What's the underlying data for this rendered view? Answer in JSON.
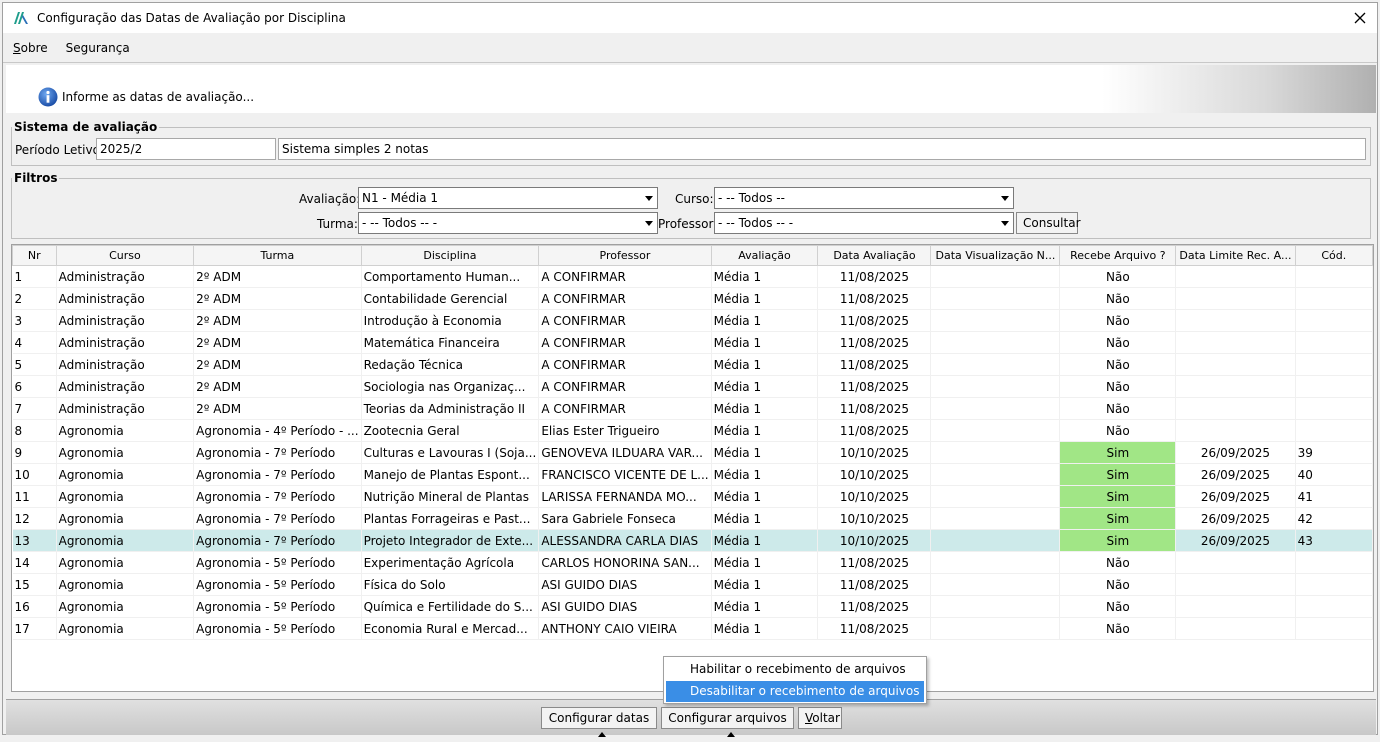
{
  "window": {
    "title": "Configuração das Datas de Avaliação por Disciplina"
  },
  "menu": {
    "sobre_first": "S",
    "sobre_rest": "obre",
    "seguranca": "Segurança"
  },
  "banner": {
    "text": "Informe as datas de avaliação..."
  },
  "sistema": {
    "legend": "Sistema de avaliação",
    "periodo_label": "Período Letivo:",
    "periodo_value": "2025/2",
    "sistema_value": "Sistema simples 2 notas"
  },
  "filtros": {
    "legend": "Filtros",
    "avaliacao_label": "Avaliação:",
    "avaliacao_value": "N1 - Média 1",
    "curso_label": "Curso:",
    "curso_value": "- -- Todos --",
    "turma_label": "Turma:",
    "turma_value": "- -- Todos -- -",
    "professor_label": "Professor:",
    "professor_value": "- -- Todos -- -",
    "consultar": "Consultar"
  },
  "table": {
    "columns": [
      "Nr",
      "Curso",
      "Turma",
      "Disciplina",
      "Professor",
      "Avaliação",
      "Data Avaliação",
      "Data Visualização N...",
      "Recebe Arquivo ?",
      "Data Limite Rec. A...",
      "Cód."
    ],
    "rows": [
      [
        "1",
        "Administração",
        "2º ADM",
        "Comportamento Human...",
        "A CONFIRMAR",
        "Média 1",
        "11/08/2025",
        "",
        "Não",
        "",
        ""
      ],
      [
        "2",
        "Administração",
        "2º ADM",
        "Contabilidade Gerencial",
        "A CONFIRMAR",
        "Média 1",
        "11/08/2025",
        "",
        "Não",
        "",
        ""
      ],
      [
        "3",
        "Administração",
        "2º ADM",
        "Introdução à Economia",
        "A CONFIRMAR",
        "Média 1",
        "11/08/2025",
        "",
        "Não",
        "",
        ""
      ],
      [
        "4",
        "Administração",
        "2º ADM",
        "Matemática Financeira",
        "A CONFIRMAR",
        "Média 1",
        "11/08/2025",
        "",
        "Não",
        "",
        ""
      ],
      [
        "5",
        "Administração",
        "2º ADM",
        "Redação Técnica",
        "A CONFIRMAR",
        "Média 1",
        "11/08/2025",
        "",
        "Não",
        "",
        ""
      ],
      [
        "6",
        "Administração",
        "2º ADM",
        "Sociologia nas Organizaç...",
        "A CONFIRMAR",
        "Média 1",
        "11/08/2025",
        "",
        "Não",
        "",
        ""
      ],
      [
        "7",
        "Administração",
        "2º ADM",
        "Teorias da Administração II",
        "A CONFIRMAR",
        "Média 1",
        "11/08/2025",
        "",
        "Não",
        "",
        ""
      ],
      [
        "8",
        "Agronomia",
        "Agronomia - 4º Período - ...",
        "Zootecnia Geral",
        "Elias Ester Trigueiro",
        "Média 1",
        "11/08/2025",
        "",
        "Não",
        "",
        ""
      ],
      [
        "9",
        "Agronomia",
        "Agronomia - 7º Período",
        "Culturas e Lavouras I (Soja...",
        "GENOVEVA ILDUARA VAR...",
        "Média 1",
        "10/10/2025",
        "",
        "Sim",
        "26/09/2025",
        "39"
      ],
      [
        "10",
        "Agronomia",
        "Agronomia - 7º Período",
        "Manejo de Plantas Espont...",
        "FRANCISCO VICENTE DE L...",
        "Média 1",
        "10/10/2025",
        "",
        "Sim",
        "26/09/2025",
        "40"
      ],
      [
        "11",
        "Agronomia",
        "Agronomia - 7º Período",
        "Nutrição Mineral de Plantas",
        "LARISSA FERNANDA MO...",
        "Média 1",
        "10/10/2025",
        "",
        "Sim",
        "26/09/2025",
        "41"
      ],
      [
        "12",
        "Agronomia",
        "Agronomia - 7º Período",
        "Plantas Forrageiras e Past...",
        "Sara Gabriele Fonseca",
        "Média 1",
        "10/10/2025",
        "",
        "Sim",
        "26/09/2025",
        "42"
      ],
      [
        "13",
        "Agronomia",
        "Agronomia - 7º Período",
        "Projeto Integrador de Exte...",
        "ALESSANDRA CARLA DIAS",
        "Média 1",
        "10/10/2025",
        "",
        "Sim",
        "26/09/2025",
        "43"
      ],
      [
        "14",
        "Agronomia",
        "Agronomia - 5º Período",
        "Experimentação Agrícola",
        "CARLOS HONORINA SAN...",
        "Média 1",
        "11/08/2025",
        "",
        "Não",
        "",
        ""
      ],
      [
        "15",
        "Agronomia",
        "Agronomia - 5º Período",
        "Física do Solo",
        "ASI GUIDO DIAS",
        "Média 1",
        "11/08/2025",
        "",
        "Não",
        "",
        ""
      ],
      [
        "16",
        "Agronomia",
        "Agronomia - 5º Período",
        "Química e Fertilidade do S...",
        "ASI GUIDO DIAS",
        "Média 1",
        "11/08/2025",
        "",
        "Não",
        "",
        ""
      ],
      [
        "17",
        "Agronomia",
        "Agronomia - 5º Período",
        "Economia Rural e Mercad...",
        "ANTHONY CAIO VIEIRA",
        "Média 1",
        "11/08/2025",
        "",
        "Não",
        "",
        ""
      ]
    ],
    "selected_row": "13",
    "highlight_color": "#a1e686",
    "selected_color": "#cdeaea"
  },
  "popup": {
    "items": [
      "Habilitar o recebimento de arquivos",
      "Desabilitar o recebimento de arquivos"
    ]
  },
  "footer": {
    "configurar_datas": "Configurar datas",
    "configurar_arquivos": "Configurar arquivos",
    "voltar_first": "V",
    "voltar_rest": "oltar"
  }
}
